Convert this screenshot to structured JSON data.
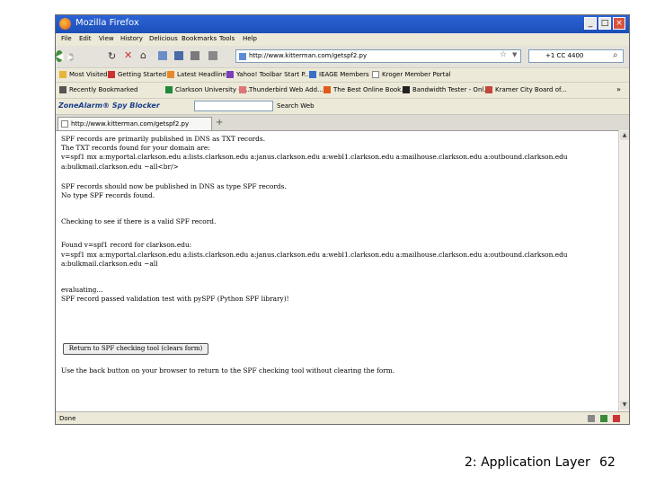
{
  "window": {
    "title": "Mozilla Firefox"
  },
  "menu": [
    "File",
    "Edit",
    "View",
    "History",
    "Delicious",
    "Bookmarks",
    "Tools",
    "Help"
  ],
  "nav": {
    "url": "http://www.kitterman.com/getspf2.py",
    "search_value": "+1 CC 4400"
  },
  "bookmarks_row1": [
    "Most Visited",
    "Getting Started",
    "Latest Headlines",
    "Yahoo! Toolbar Start P...",
    "IEAGE Members",
    "Kroger Member Portal"
  ],
  "bookmarks_row2": [
    "Recently Bookmarked",
    "Clarkson University - T...",
    "Thunderbird Web Add...",
    "The Best Online Book...",
    "Bandwidth Tester - Onl...",
    "Kramer City Board of..."
  ],
  "zonealarm": {
    "logo": "ZoneAlarm® Spy Blocker",
    "search_label": "Search Web"
  },
  "tab": {
    "title": "http://www.kitterman.com/getspf2.py"
  },
  "content": {
    "lines": [
      "SPF records are primarily published in DNS as TXT records.",
      "The TXT records found for your domain are:",
      "v=spf1 mx a:myportal.clarkson.edu a:lists.clarkson.edu a:janus.clarkson.edu a:webl1.clarkson.edu a:mailhouse.clarkson.edu a:outbound.clarkson.edu",
      "a:bulkmail.clarkson.edu ~all<br/>",
      "SPF records should now be published in DNS as type SPF records.",
      "No type SPF records found.",
      "Checking to see if there is a valid SPF record.",
      "Found v=spf1 record for clarkson.edu:",
      "v=spf1 mx a:myportal.clarkson.edu a:lists.clarkson.edu a:janus.clarkson.edu a:webl1.clarkson.edu a:mailhouse.clarkson.edu a:outbound.clarkson.edu",
      "a:bulkmail.clarkson.edu ~all",
      "evaluating...",
      "SPF record passed validation test with pySPF (Python SPF library)!",
      "Use the back button on your browser to return to the SPF checking tool without clearing the form."
    ],
    "return_button": "Return to SPF checking tool (clears form)"
  },
  "status": {
    "text": "Done"
  },
  "slide": {
    "footer": "2: Application Layer",
    "page": "62"
  }
}
